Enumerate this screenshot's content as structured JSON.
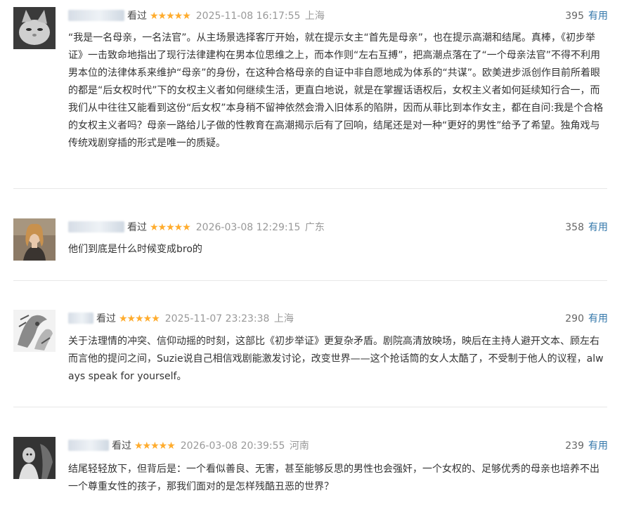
{
  "reviews": [
    {
      "username": "",
      "status": "看过",
      "rating_stars": "★★★★★",
      "rating": 5,
      "time": "2025-11-08 16:17:55",
      "location": "上海",
      "votes": "395",
      "useful_label": "有用",
      "avatar_icon": "cat-avatar-icon",
      "content": "“我是一名母亲，一名法官”。从主场景选择客厅开始，就在提示女主“首先是母亲”，也在提示高潮和结尾。真棒，《初步举证》一击致命地指出了现行法律建构在男本位思维之上，而本作则“左右互搏”，把高潮点落在了“一个母亲法官”不得不利用男本位的法律体系来维护“母亲”的身份，在这种合格母亲的自证中非自愿地成为体系的“共谋”。欧美进步派创作目前所着眼的都是“后女权时代”下的女权主义者如何继续生活，更直白地说，就是在掌握话语权后，女权主义者如何延续知行合一，而我们从中往往又能看到这份“后女权”本身稍不留神依然会滑入旧体系的陷阱，因而从菲比到本作女主，都在自问:我是个合格的女权主义者吗？母亲一路给儿子做的性教育在高潮揭示后有了回响，结尾还是对一种“更好的男性”给予了希望。独角戏与传统戏剧穿插的形式是唯一的质疑。"
    },
    {
      "username": "",
      "status": "看过",
      "rating_stars": "★★★★★",
      "rating": 5,
      "time": "2026-03-08 12:29:15",
      "location": "广东",
      "votes": "358",
      "useful_label": "有用",
      "avatar_icon": "woman-portrait-avatar-icon",
      "content": "他们到底是什么时候变成bro的"
    },
    {
      "username": "",
      "status": "看过",
      "rating_stars": "★★★★★",
      "rating": 5,
      "time": "2025-11-07 23:23:38",
      "location": "上海",
      "votes": "290",
      "useful_label": "有用",
      "avatar_icon": "sketch-avatar-icon",
      "content": "关于法理情的冲突、信仰动摇的时刻，这部比《初步举证》更复杂矛盾。剧院高清放映场，映后在主持人避开文本、顾左右而言他的提问之间，Suzie说自己相信戏剧能激发讨论，改变世界——这个抢话筒的女人太酷了，不受制于他人的议程，always speak for yourself。"
    },
    {
      "username": "",
      "status": "看过",
      "rating_stars": "★★★★★",
      "rating": 5,
      "time": "2026-03-08 20:39:55",
      "location": "河南",
      "votes": "239",
      "useful_label": "有用",
      "avatar_icon": "dark-photo-avatar-icon",
      "content": "结尾轻轻放下，但背后是：一个看似善良、无害，甚至能够反思的男性也会强奸，一个女权的、足够优秀的母亲也培养不出一个尊重女性的孩子，那我们面对的是怎样残酷丑恶的世界？"
    }
  ],
  "colors": {
    "star": "#ffac2d",
    "useful_link": "#3377aa",
    "meta_gray": "#999999",
    "text": "#333333"
  }
}
